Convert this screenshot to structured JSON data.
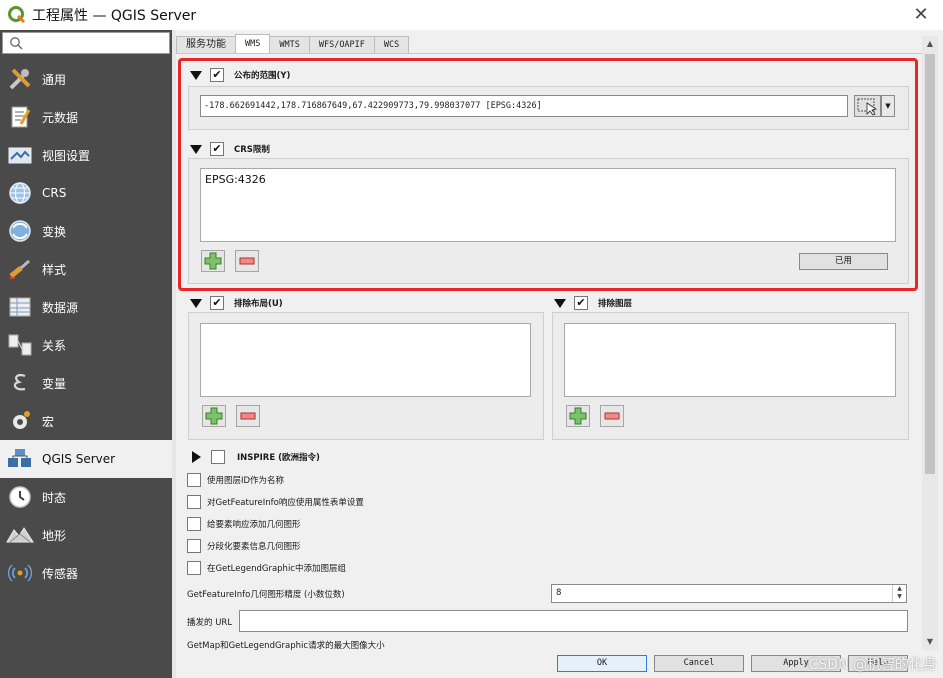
{
  "window": {
    "title": "工程属性 — QGIS Server"
  },
  "search": {
    "placeholder": ""
  },
  "sidebar": {
    "items": [
      {
        "label": "通用",
        "icon": "tools-icon"
      },
      {
        "label": "元数据",
        "icon": "metadata-icon"
      },
      {
        "label": "视图设置",
        "icon": "view-settings-icon"
      },
      {
        "label": "CRS",
        "icon": "globe-crs-icon"
      },
      {
        "label": "变换",
        "icon": "transform-icon"
      },
      {
        "label": "样式",
        "icon": "paintbrush-icon"
      },
      {
        "label": "数据源",
        "icon": "datasource-icon"
      },
      {
        "label": "关系",
        "icon": "relations-icon"
      },
      {
        "label": "变量",
        "icon": "variable-epsilon-icon"
      },
      {
        "label": "宏",
        "icon": "macro-gear-icon"
      },
      {
        "label": "QGIS Server",
        "icon": "server-icon",
        "active": true
      },
      {
        "label": "时态",
        "icon": "clock-icon"
      },
      {
        "label": "地形",
        "icon": "terrain-icon"
      },
      {
        "label": "传感器",
        "icon": "sensor-icon"
      }
    ]
  },
  "tabs": [
    {
      "label": "服务功能"
    },
    {
      "label": "WMS",
      "active": true
    },
    {
      "label": "WMTS"
    },
    {
      "label": "WFS/OAPIF"
    },
    {
      "label": "WCS"
    }
  ],
  "wms": {
    "extent_group": {
      "label": "公布的范围(Y)",
      "checked": true,
      "value": "-178.662691442,178.716867649,67.422909773,79.998037077 [EPSG:4326]"
    },
    "crs_group": {
      "label": "CRS限制",
      "checked": true,
      "items": [
        "EPSG:4326"
      ],
      "used_label": "已用"
    },
    "exclude_layouts": {
      "label": "排除布局(U)",
      "checked": true
    },
    "exclude_layers": {
      "label": "排除图层",
      "checked": true
    },
    "inspire": {
      "label": "INSPIRE (欧洲指令)",
      "checked": false
    },
    "options": [
      {
        "label": "使用图层ID作为名称",
        "checked": false
      },
      {
        "label": "对GetFeatureInfo响应使用属性表单设置",
        "checked": false
      },
      {
        "label": "给要素响应添加几何图形",
        "checked": false
      },
      {
        "label": "分段化要素信息几何图形",
        "checked": false
      },
      {
        "label": "在GetLegendGraphic中添加图层组",
        "checked": false
      }
    ],
    "precision_label": "GetFeatureInfo几何图形精度 (小数位数)",
    "precision_value": "8",
    "url_label": "播发的 URL",
    "url_value": "",
    "max_size_label": "GetMap和GetLegendGraphic请求的最大图像大小"
  },
  "buttons": {
    "ok": "OK",
    "cancel": "Cancel",
    "apply": "Apply",
    "help": "Help"
  },
  "watermark": "CSDN @机智的化身"
}
